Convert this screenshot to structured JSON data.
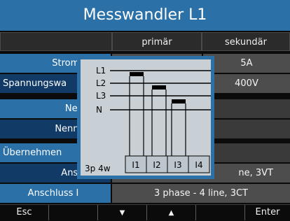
{
  "title": "Messwandler L1",
  "columns": {
    "primary": "primär",
    "secondary": "sekundär"
  },
  "rows": [
    {
      "label": "Stromwandl",
      "secondary": "5A"
    },
    {
      "label": "Spannungswa",
      "secondary": "400V"
    },
    {
      "label": "Nennstro",
      "secondary": ""
    },
    {
      "label": "Nennspann",
      "secondary": ""
    },
    {
      "label": "Übernehmen",
      "secondary": ""
    },
    {
      "label": "Anschluss",
      "value": "ne, 3VT"
    },
    {
      "label": "Anschluss I",
      "value": "3 phase - 4 line, 3CT"
    }
  ],
  "popup": {
    "lines": [
      "L1",
      "L2",
      "L3",
      "N"
    ],
    "terminals": [
      "I1",
      "I2",
      "I3",
      "I4"
    ],
    "mode": "3p 4w"
  },
  "softkeys": {
    "esc": "Esc",
    "down_icon": "down-arrow-icon",
    "up_icon": "up-arrow-icon",
    "enter": "Enter"
  },
  "colors": {
    "title_blue": "#2b71a8",
    "dark_blue": "#123a66",
    "value_gray": "#4d4d4d",
    "popup_bg": "#c8d0d5"
  }
}
